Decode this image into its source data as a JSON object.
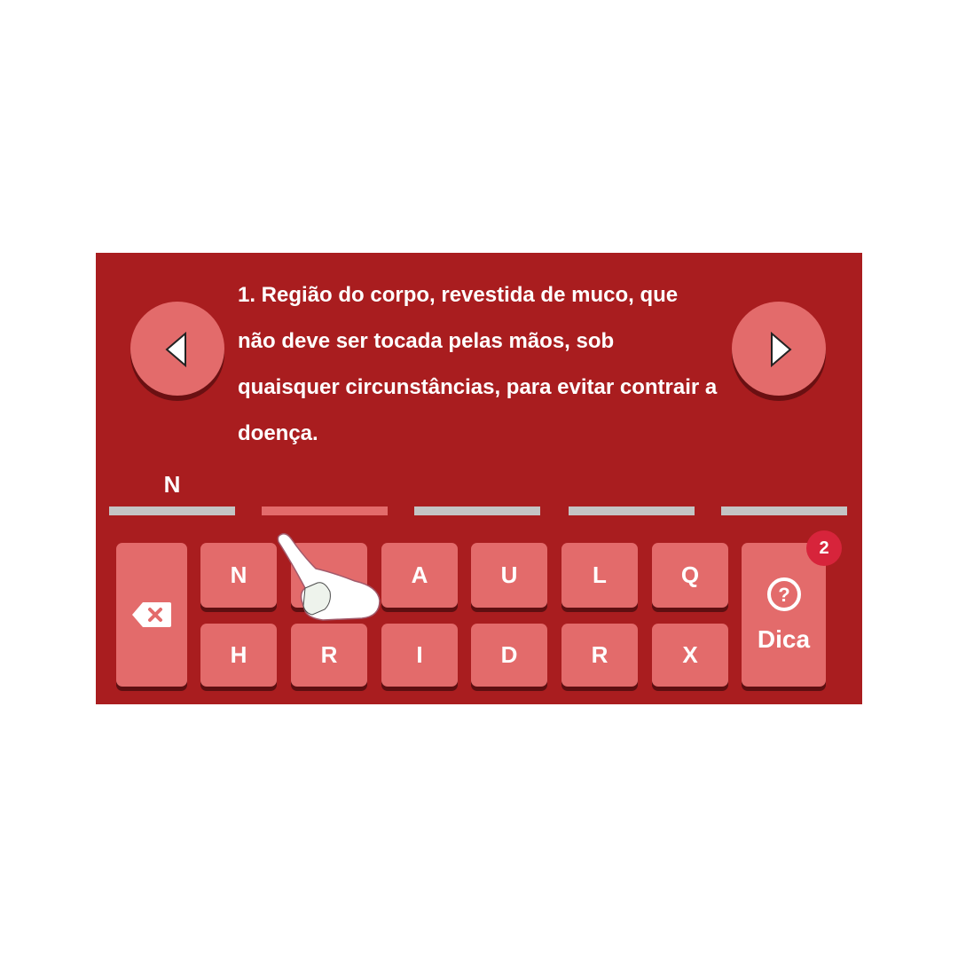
{
  "question": {
    "text": "1. Região do corpo, revestida de muco, que não deve ser tocada pelas mãos, sob quaisquer circunstâncias, para evitar contrair a doença."
  },
  "answer_slots": [
    {
      "letter": "N",
      "active": false
    },
    {
      "letter": "",
      "active": true
    },
    {
      "letter": "",
      "active": false
    },
    {
      "letter": "",
      "active": false
    },
    {
      "letter": "",
      "active": false
    }
  ],
  "keyboard": {
    "row1": [
      "N",
      "",
      "A",
      "U",
      "L",
      "Q"
    ],
    "row2": [
      "H",
      "R",
      "I",
      "D",
      "R",
      "X"
    ],
    "hint_label": "Dica",
    "hint_count": "2"
  },
  "icons": {
    "prev": "left-triangle-icon",
    "next": "right-triangle-icon",
    "backspace": "backspace-icon",
    "hint": "question-circle-icon",
    "pointer": "pointing-hand-icon"
  },
  "colors": {
    "panel": "#a91d1f",
    "key": "#e36b6b",
    "key_shadow": "#5e0f11",
    "slot_line": "#c4c4c4",
    "slot_active": "#e36b6b",
    "badge": "#d7243b"
  }
}
